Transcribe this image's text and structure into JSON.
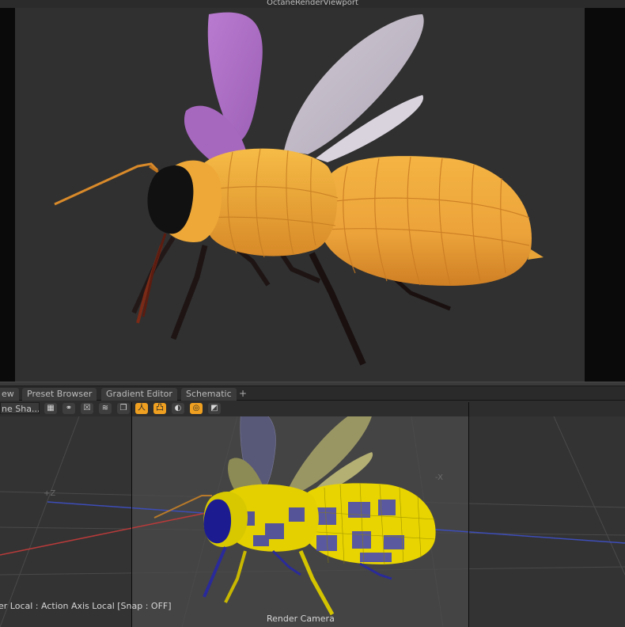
{
  "viewport": {
    "title": "OctaneRenderViewport"
  },
  "tabs": [
    {
      "label": "ew"
    },
    {
      "label": "Preset Browser"
    },
    {
      "label": "Gradient Editor"
    },
    {
      "label": "Schematic"
    }
  ],
  "tab_add_label": "+",
  "toolbar": {
    "shader_dropdown": "ne Sha...",
    "buttons": [
      {
        "icon": "checker-icon",
        "glyph": "▦",
        "active": false
      },
      {
        "icon": "rings-icon",
        "glyph": "⚭",
        "active": false
      },
      {
        "icon": "cross-box-icon",
        "glyph": "☒",
        "active": false
      },
      {
        "icon": "wave-lines-icon",
        "glyph": "≋",
        "active": false
      },
      {
        "icon": "copy-frame-icon",
        "glyph": "❐",
        "active": false
      },
      {
        "icon": "figure-icon",
        "glyph": "人",
        "active": true
      },
      {
        "icon": "stamp-icon",
        "glyph": "凸",
        "active": true
      },
      {
        "icon": "half-circle-icon",
        "glyph": "◐",
        "active": false
      },
      {
        "icon": "double-ring-icon",
        "glyph": "◎",
        "active": true
      },
      {
        "icon": "diagonal-icon",
        "glyph": "◩",
        "active": false
      }
    ]
  },
  "bottom": {
    "status": "er Local : Action Axis Local  [Snap : OFF]",
    "camera_label": "Render Camera",
    "axis_z": "+Z",
    "axis_x": "-X"
  },
  "colors": {
    "accent": "#f0a020",
    "render_bg": "#303030",
    "bee_body": "#f0a030",
    "wireframe": "#e8d800"
  }
}
